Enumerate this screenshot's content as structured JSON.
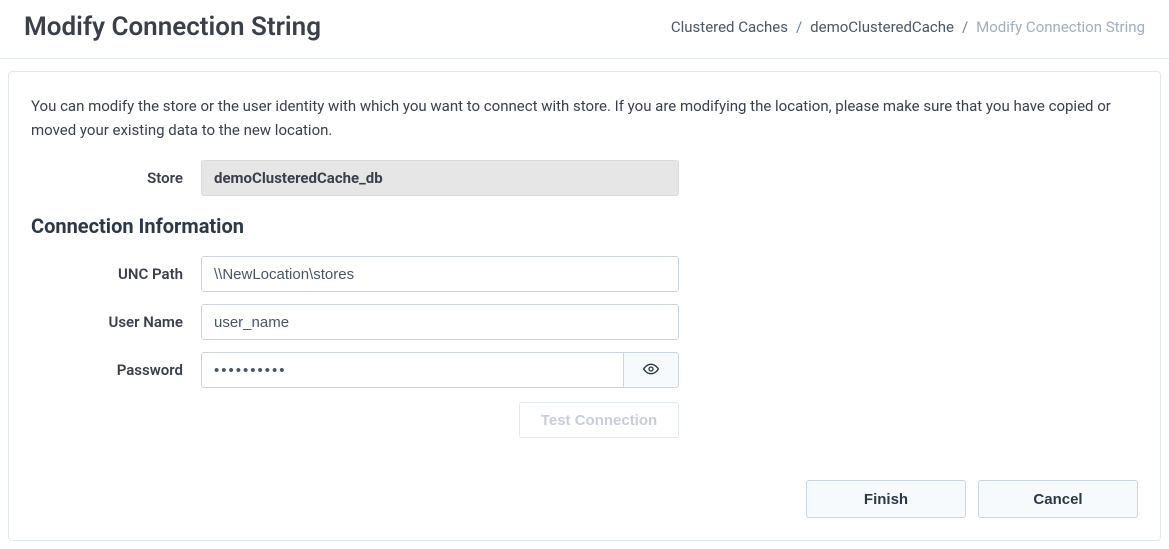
{
  "header": {
    "title": "Modify Connection String",
    "breadcrumb": {
      "item1": "Clustered Caches",
      "item2": "demoClusteredCache",
      "item3": "Modify Connection String",
      "sep": "/"
    }
  },
  "panel": {
    "intro": "You can modify the store or the user identity with which you want to connect with store. If you are modifying the location, please make sure that you have copied or moved your existing data to the new location.",
    "store_label": "Store",
    "store_value": "demoClusteredCache_db",
    "section_title": "Connection Information",
    "unc_label": "UNC Path",
    "unc_value": "\\\\NewLocation\\stores",
    "username_label": "User Name",
    "username_value": "user_name",
    "password_label": "Password",
    "password_value": "••••••••••",
    "test_label": "Test Connection"
  },
  "footer": {
    "finish": "Finish",
    "cancel": "Cancel"
  }
}
